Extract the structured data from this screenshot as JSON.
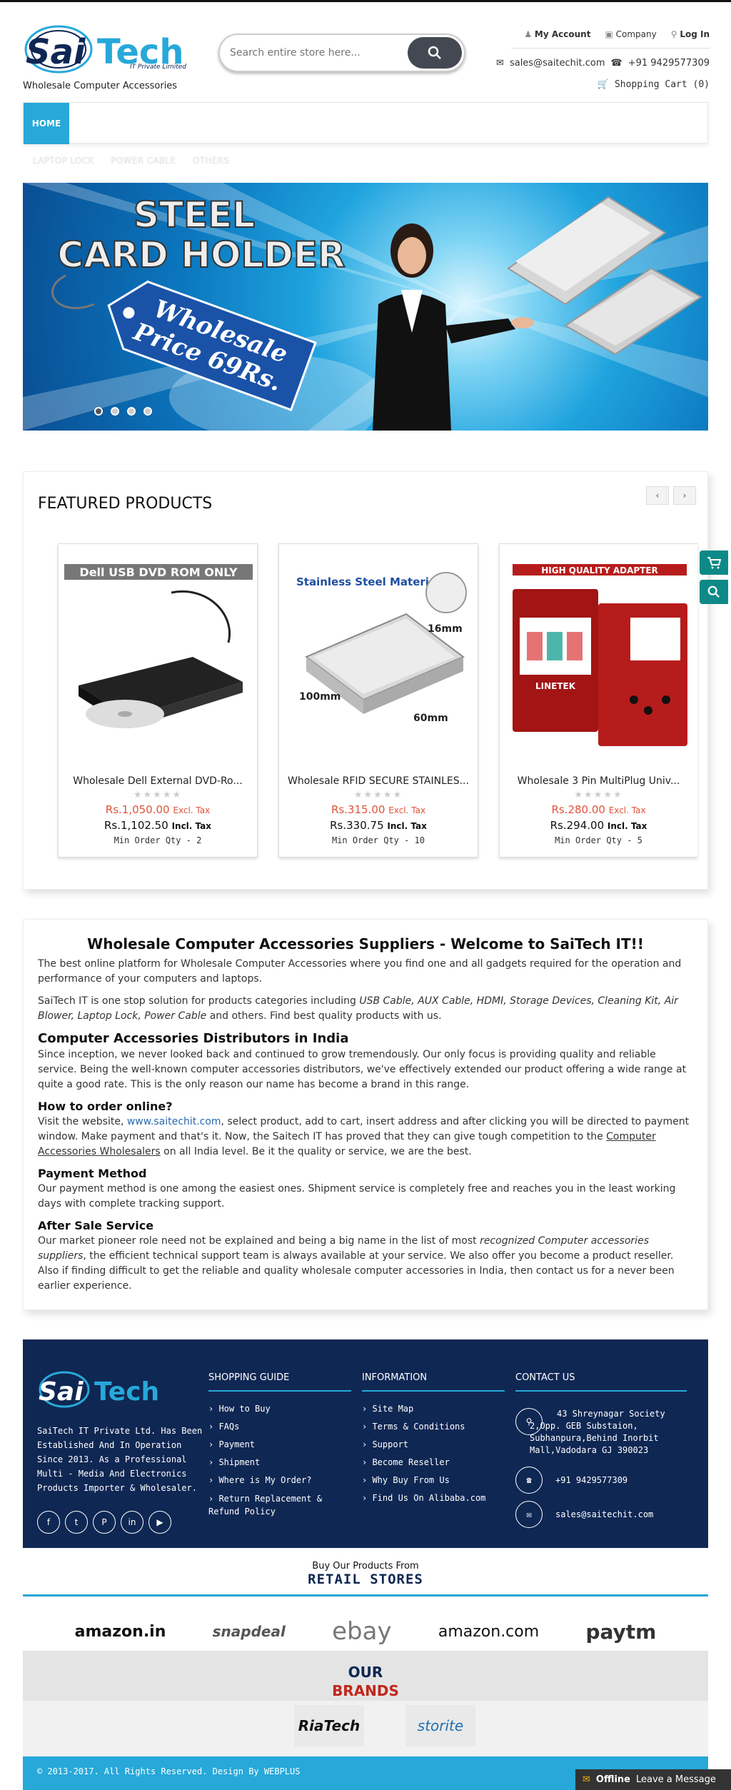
{
  "header": {
    "logo_text": "SaiTech",
    "logo_sub": "IT Private Limited",
    "tagline": "Wholesale Computer Accessories",
    "search_placeholder": "Search entire store here...",
    "links": [
      "My Account",
      "Company",
      "Log In"
    ],
    "email": "sales@saitechit.com",
    "phone": "+91  9429577309",
    "cart": "Shopping Cart (0)"
  },
  "nav": {
    "home": "HOME",
    "sub_items": [
      "LAPTOP LOCK",
      "POWER CABLE",
      "OTHERS"
    ]
  },
  "banner": {
    "line1": "STEEL",
    "line2": "CARD HOLDER",
    "tag1": "Wholesale",
    "tag2": "Price  69Rs.",
    "slides": 4,
    "active": 1
  },
  "featured": {
    "title": "FEATURED PRODUCTS",
    "products": [
      {
        "name": "Wholesale Dell External DVD-Ro...",
        "label": "Dell USB DVD ROM ONLY",
        "price_excl": "Rs.1,050.00",
        "price_incl": "Rs.1,102.50",
        "moq": "Min Order Qty - 2"
      },
      {
        "name": "Wholesale RFID SECURE STAINLES...",
        "label": "Stainless Steel Material",
        "dim1": "16mm",
        "dim2": "100mm",
        "dim3": "60mm",
        "price_excl": "Rs.315.00",
        "price_incl": "Rs.330.75",
        "moq": "Min Order Qty - 10"
      },
      {
        "name": "Wholesale 3 Pin MultiPlug Univ...",
        "label": "HIGH QUALITY ADAPTER",
        "brand": "LINETEK",
        "price_excl": "Rs.280.00",
        "price_incl": "Rs.294.00",
        "moq": "Min Order Qty - 5"
      }
    ],
    "excl_label": "Excl. Tax",
    "incl_label": "Incl. Tax"
  },
  "content": {
    "title": "Wholesale Computer Accessories Suppliers - Welcome to SaiTech IT!!",
    "p1": "The best online platform for Wholesale Computer Accessories where you find one and all gadgets required for the operation and performance of your computers and laptops.",
    "p2a": "SaiTech IT is one stop solution for products categories including ",
    "p2b": "USB Cable, AUX Cable, HDMI, Storage Devices, Cleaning Kit, Air Blower, Laptop Lock, Power Cable",
    "p2c": " and others. Find best quality products with us.",
    "h2": "Computer Accessories Distributors in India",
    "p3": "Since inception, we never looked back and continued to grow tremendously. Our only focus is providing quality and reliable service. Being the well-known computer accessories distributors, we've effectively extended our product offering a wide range at quite a good rate. This is the only reason our name has become a brand in this range.",
    "h3": "How to order online?",
    "p4a": "Visit the website, ",
    "p4link": "www.saitechit.com",
    "p4b": ", select product, add to cart, insert address and after clicking you will be directed to payment window. Make payment and that's it. Now, the Saitech IT has proved that they can give tough competition to the ",
    "p4u": "Computer Accessories Wholesalers",
    "p4c": " on all India level. Be it the quality or service, we are the best.",
    "h4": "Payment Method",
    "p5": "Our payment method is one among the easiest ones. Shipment service is completely free and reaches you in the least working days with complete tracking support.",
    "h5": "After Sale Service",
    "p6a": "Our market pioneer role need not be explained and being a big name in the list of most ",
    "p6i": "recognized Computer accessories suppliers",
    "p6b": ", the efficient technical support team is always available at your service. We also offer you become a product reseller. Also if finding difficult to get the reliable and quality wholesale computer accessories in India, then contact us for a never been earlier experience."
  },
  "footer": {
    "about": "SaiTech IT Private Ltd. Has Been Established And In Operation Since 2013. As a Professional Multi - Media And Electronics Products Importer & Wholesaler.",
    "shopping_title": "SHOPPING GUIDE",
    "shopping": [
      "How to Buy",
      "FAQs",
      "Payment",
      "Shipment",
      "Where is My Order?",
      "Return Replacement & Refund Policy"
    ],
    "info_title": "INFORMATION",
    "info": [
      "Site Map",
      "Terms & Conditions",
      "Support",
      "Become Reseller",
      "Why Buy From Us",
      "Find Us On Alibaba.com"
    ],
    "contact_title": "CONTACT US",
    "address": "43 Shreynagar Society 2,Opp. GEB Substaion, Subhanpura,Behind Inorbit Mall,Vadodara GJ 390023",
    "phone": "+91 9429577309",
    "email": "sales@saitechit.com"
  },
  "retail": {
    "small": "Buy Our Products From",
    "big": "RETAIL STORES",
    "stores": [
      "amazon.in",
      "snapdeal",
      "ebay",
      "amazon.com",
      "paytm"
    ]
  },
  "brands": {
    "our": "OUR",
    "title": "BRANDS",
    "list": [
      "RiaTech",
      "storite"
    ]
  },
  "copyright": "© 2013-2017. All Rights Reserved. Design By",
  "designer": "WEBPLUS",
  "chat": {
    "status": "Offline",
    "action": "Leave a Message"
  },
  "colors": {
    "accent": "#27a8d9",
    "navy": "#0f2753",
    "price": "#e0533a",
    "teal": "#0d8a87"
  }
}
